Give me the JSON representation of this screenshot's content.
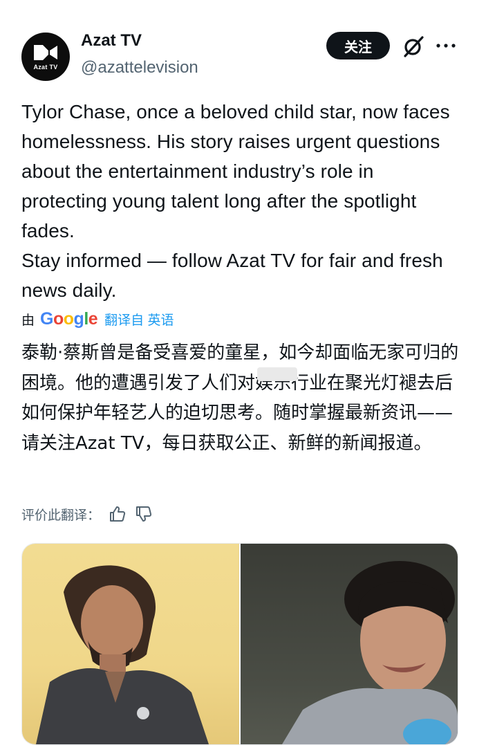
{
  "account": {
    "name": "Azat TV",
    "handle": "@azattelevision",
    "avatar_text": "Azat TV"
  },
  "actions": {
    "follow_label": "关注",
    "grok_icon": "slashed-circle-icon",
    "more_icon": "more-dots-icon"
  },
  "tweet": {
    "line1": "Tylor Chase, once a beloved child star, now faces homelessness. His story raises urgent questions about the entertainment industry’s role in protecting young talent long after the spotlight fades.",
    "line2": "Stay informed — follow Azat TV for fair and fresh news daily."
  },
  "translation": {
    "by": "由",
    "google_letters": [
      "G",
      "o",
      "o",
      "g",
      "l",
      "e"
    ],
    "link": "翻译自 英语",
    "text": "泰勒·蔡斯曾是备受喜爱的童星，如今却面临无家可归的困境。他的遭遇引发了人们对娱乐行业在聚光灯褪去后如何保护年轻艺人的迫切思考。随时掌握最新资讯——请关注Azat TV，每日获取公正、新鲜的新闻报道。",
    "rate_label": "评价此翻译："
  },
  "colors": {
    "text": "#0f1419",
    "secondary": "#536471",
    "link": "#1d9bf0",
    "button_bg": "#0f1419"
  }
}
